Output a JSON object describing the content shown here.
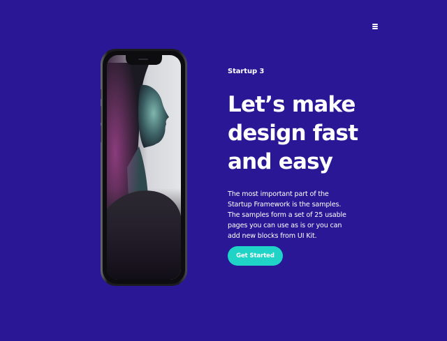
{
  "header": {
    "menu_icon": "hamburger-menu-icon"
  },
  "hero": {
    "eyebrow": "Startup 3",
    "headline": [
      "Let’s make",
      "design fast",
      "and easy"
    ],
    "description": [
      "The most important part of the",
      "Startup Framework is the samples.",
      "The samples form a set of 25 usable",
      "pages you can use as is or you can",
      "add new blocks from UI Kit."
    ],
    "cta_label": "Get Started"
  },
  "colors": {
    "background": "#2a1795",
    "accent": "#1fd3c6",
    "text": "#ffffff"
  }
}
